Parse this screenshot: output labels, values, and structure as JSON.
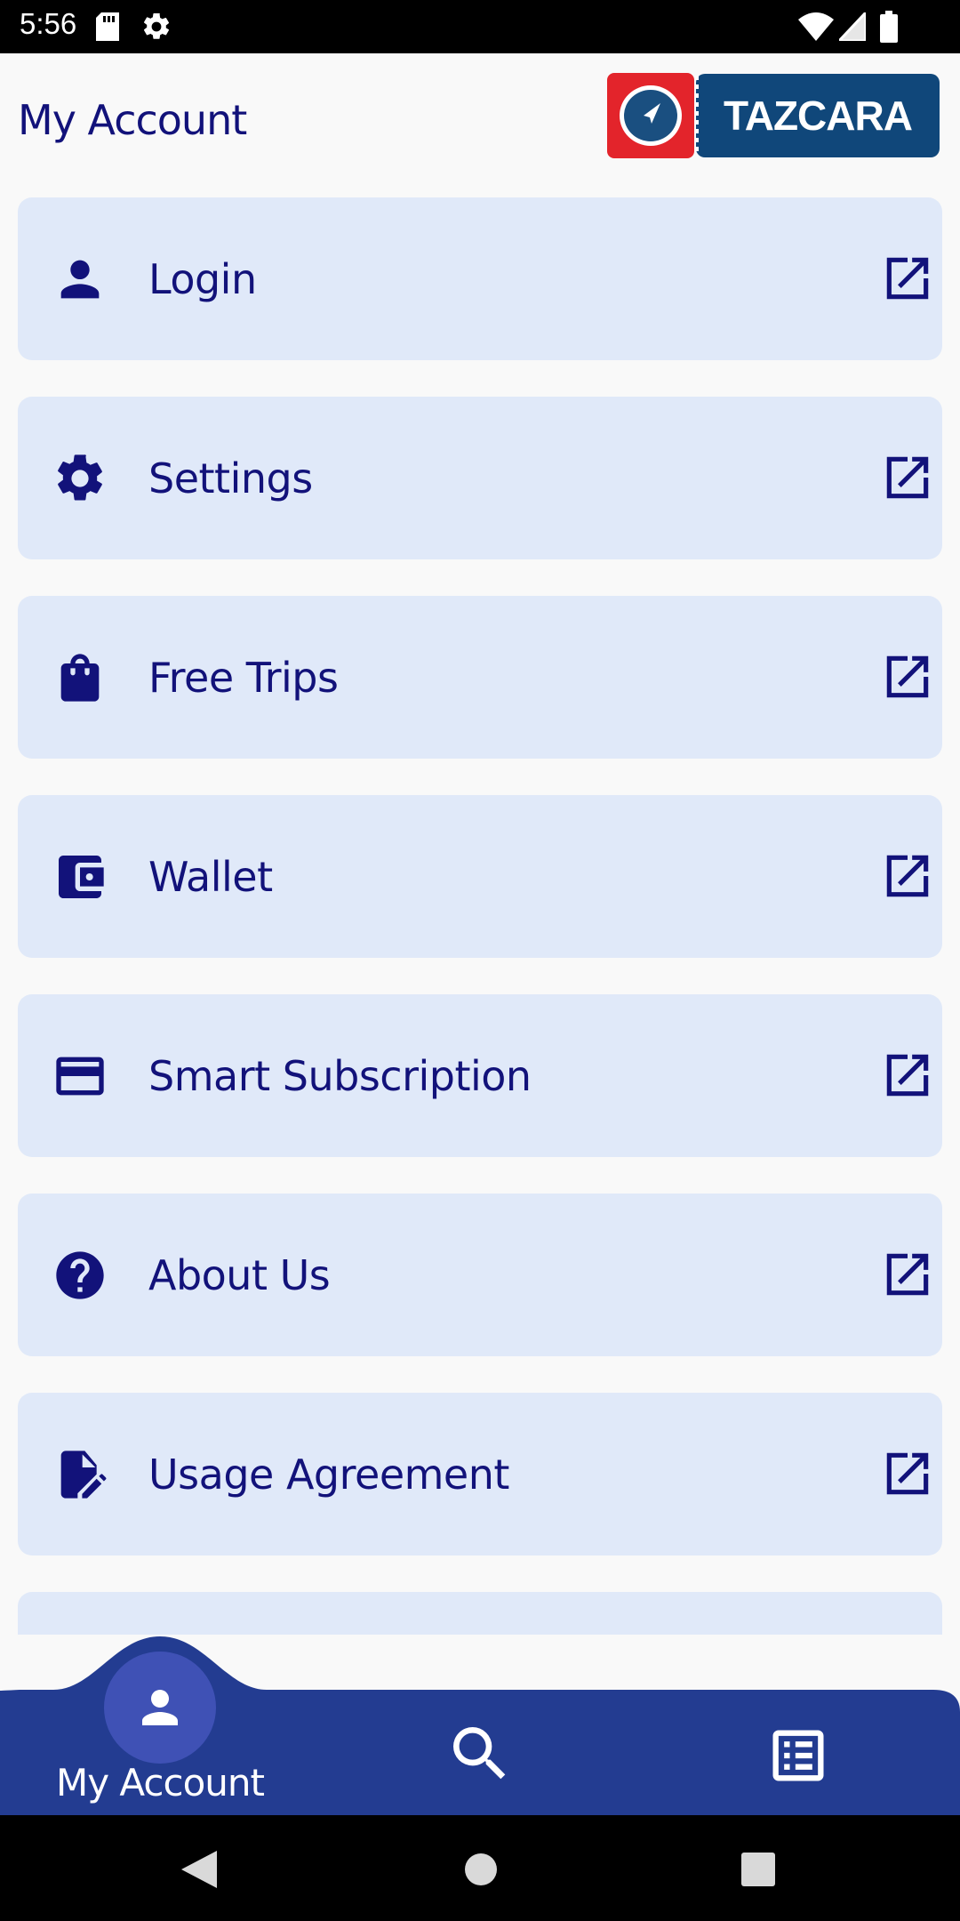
{
  "status_bar": {
    "time": "5:56",
    "icons": [
      "sd-card-icon",
      "settings-gear-icon",
      "wifi-icon",
      "signal-icon",
      "battery-icon"
    ]
  },
  "header": {
    "title": "My Account",
    "logo_text": "TAZCARA"
  },
  "menu": {
    "items": [
      {
        "label": "Login",
        "icon": "person-icon"
      },
      {
        "label": "Settings",
        "icon": "gear-icon"
      },
      {
        "label": "Free Trips",
        "icon": "shopping-bag-icon"
      },
      {
        "label": "Wallet",
        "icon": "wallet-icon"
      },
      {
        "label": "Smart Subscription",
        "icon": "credit-card-icon"
      },
      {
        "label": "About Us",
        "icon": "help-circle-icon"
      },
      {
        "label": "Usage Agreement",
        "icon": "edit-document-icon"
      }
    ],
    "trailing_icon": "open-in-new-icon"
  },
  "bottom_nav": {
    "active_label": "My Account",
    "items": [
      "account-icon",
      "search-icon",
      "list-icon"
    ]
  },
  "colors": {
    "accent": "#12127a",
    "card": "#e0e9f9",
    "nav": "#233c91",
    "active_bubble": "#3f51b5",
    "logo_red": "#e3242b",
    "logo_blue": "#10477a"
  }
}
